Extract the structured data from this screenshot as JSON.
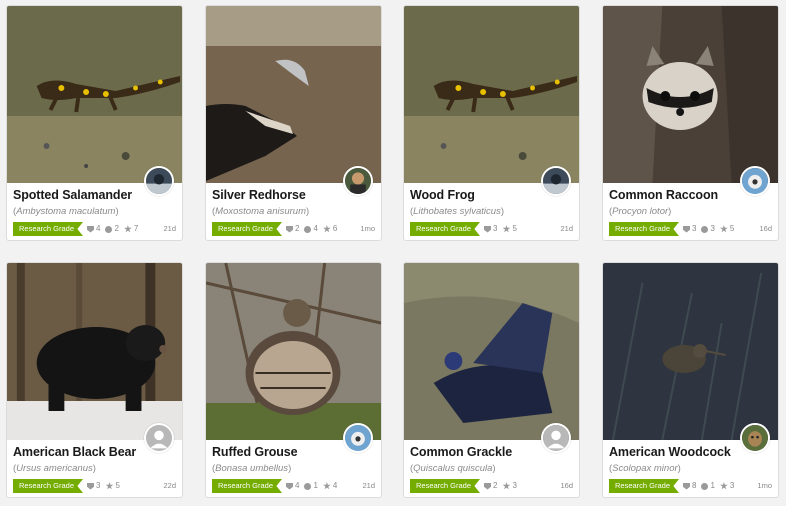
{
  "badge_color": "#74ac00",
  "cards": [
    {
      "common": "Spotted Salamander",
      "scientific": "Ambystoma maculatum",
      "grade": "Research Grade",
      "ids": "4",
      "comments": "2",
      "faves": "7",
      "age": "21d",
      "photo": "salamander-photo",
      "avatar": "user-avatar-bird"
    },
    {
      "common": "Silver Redhorse",
      "scientific": "Moxostoma anisurum",
      "grade": "Research Grade",
      "ids": "2",
      "comments": "4",
      "faves": "6",
      "age": "1mo",
      "photo": "osprey-with-fish-photo",
      "avatar": "user-avatar-person"
    },
    {
      "common": "Wood Frog",
      "scientific": "Lithobates sylvaticus",
      "grade": "Research Grade",
      "ids": "3",
      "comments": "",
      "faves": "5",
      "age": "21d",
      "photo": "salamander-photo",
      "avatar": "user-avatar-bird"
    },
    {
      "common": "Common Raccoon",
      "scientific": "Procyon lotor",
      "grade": "Research Grade",
      "ids": "3",
      "comments": "3",
      "faves": "5",
      "age": "16d",
      "photo": "raccoon-photo",
      "avatar": "user-avatar-bird"
    },
    {
      "common": "American Black Bear",
      "scientific": "Ursus americanus",
      "grade": "Research Grade",
      "ids": "3",
      "comments": "",
      "faves": "5",
      "age": "22d",
      "photo": "black-bear-photo",
      "avatar": "default-avatar"
    },
    {
      "common": "Ruffed Grouse",
      "scientific": "Bonasa umbellus",
      "grade": "Research Grade",
      "ids": "4",
      "comments": "1",
      "faves": "4",
      "age": "21d",
      "photo": "grouse-photo",
      "avatar": "user-avatar-bird"
    },
    {
      "common": "Common Grackle",
      "scientific": "Quiscalus quiscula",
      "grade": "Research Grade",
      "ids": "2",
      "comments": "",
      "faves": "3",
      "age": "16d",
      "photo": "grackle-photo",
      "avatar": "default-avatar"
    },
    {
      "common": "American Woodcock",
      "scientific": "Scolopax minor",
      "grade": "Research Grade",
      "ids": "8",
      "comments": "1",
      "faves": "3",
      "age": "1mo",
      "photo": "woodcock-photo",
      "avatar": "user-avatar-dog"
    }
  ]
}
